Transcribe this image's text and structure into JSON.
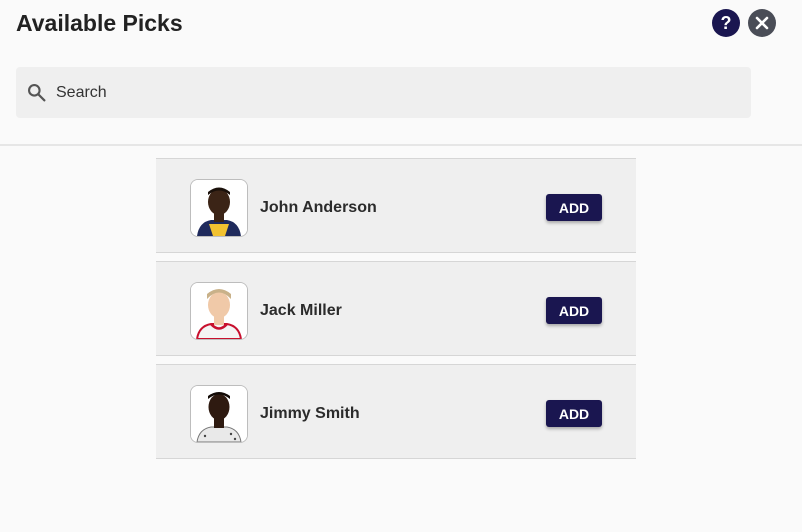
{
  "header": {
    "title": "Available Picks",
    "help_icon": "help-circle-icon",
    "close_icon": "close-circle-icon"
  },
  "search": {
    "placeholder": "Search",
    "value": "",
    "icon": "search-icon"
  },
  "players": [
    {
      "name": "John Anderson",
      "action_label": "ADD",
      "avatar_icon": "player-headshot"
    },
    {
      "name": "Jack Miller",
      "action_label": "ADD",
      "avatar_icon": "player-headshot"
    },
    {
      "name": "Jimmy Smith",
      "action_label": "ADD",
      "avatar_icon": "player-headshot"
    }
  ],
  "colors": {
    "primary": "#1a1650",
    "close": "#4a4d57",
    "card_bg": "#efefef",
    "page_bg": "#fafafa"
  }
}
